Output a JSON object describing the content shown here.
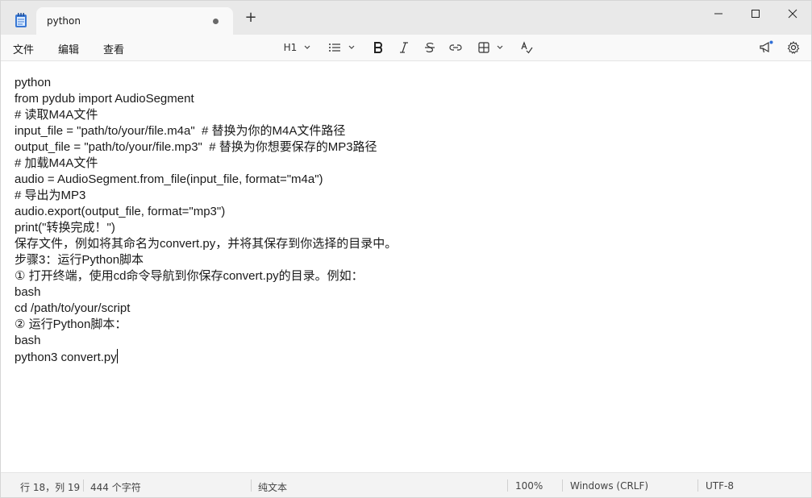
{
  "window": {
    "tab_title": "python",
    "new_tab_symbol": "+"
  },
  "menu": {
    "file": "文件",
    "edit": "编辑",
    "view": "查看"
  },
  "toolbar": {
    "heading": "H1"
  },
  "editor": {
    "lines": [
      "python",
      "from pydub import AudioSegment",
      "# 读取M4A文件",
      "input_file = \"path/to/your/file.m4a\"  # 替换为你的M4A文件路径",
      "output_file = \"path/to/your/file.mp3\"  # 替换为你想要保存的MP3路径",
      "# 加载M4A文件",
      "audio = AudioSegment.from_file(input_file, format=\"m4a\")",
      "# 导出为MP3",
      "audio.export(output_file, format=\"mp3\")",
      "print(\"转换完成！\")",
      "保存文件，例如将其命名为convert.py，并将其保存到你选择的目录中。",
      "步骤3：运行Python脚本",
      "① 打开终端，使用cd命令导航到你保存convert.py的目录。例如：",
      "bash",
      "cd /path/to/your/script",
      "② 运行Python脚本：",
      "bash",
      "python3 convert.py"
    ]
  },
  "status": {
    "position": "行 18，列 19",
    "chars": "444 个字符",
    "format": "纯文本",
    "zoom": "100%",
    "line_ending": "Windows (CRLF)",
    "encoding": "UTF-8"
  }
}
